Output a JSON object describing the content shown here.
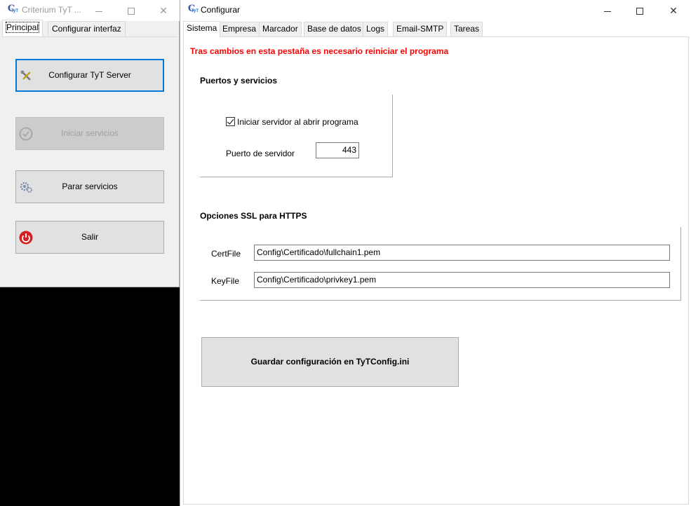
{
  "left_window": {
    "title": "Criterium TyT ...",
    "app_icon_letter": "C",
    "app_icon_sub": "TyT",
    "tabs": [
      {
        "label": "Principal"
      },
      {
        "label": "Configurar interfaz"
      }
    ],
    "buttons": {
      "configure": "Configurar TyT Server",
      "start": "Iniciar servicios",
      "stop": "Parar servicios",
      "exit": "Salir"
    }
  },
  "right_window": {
    "title": "Configurar",
    "app_icon_letter": "C",
    "app_icon_sub": "TyT",
    "tabs": [
      {
        "label": "Sistema"
      },
      {
        "label": "Empresa"
      },
      {
        "label": "Marcador"
      },
      {
        "label": "Base de datos"
      },
      {
        "label": "Logs"
      },
      {
        "label": "Email-SMTP"
      },
      {
        "label": "Tareas"
      }
    ],
    "warning": "Tras cambios en esta pestaña es necesario reiniciar el programa",
    "ports_group": {
      "title": "Puertos y servicios",
      "start_on_open_label": "Iniciar servidor al abrir programa",
      "start_on_open_checked": true,
      "port_label": "Puerto de servidor",
      "port_value": "443"
    },
    "ssl_group": {
      "title": "Opciones SSL para HTTPS",
      "certfile_label": "CertFile",
      "certfile_value": "Config\\Certificado\\fullchain1.pem",
      "keyfile_label": "KeyFile",
      "keyfile_value": "Config\\Certificado\\privkey1.pem"
    },
    "save_button": "Guardar configuración en TyTConfig.ini"
  },
  "colors": {
    "warning": "#ff0000",
    "focus_border": "#0078d7",
    "button_face": "#e1e1e1"
  }
}
